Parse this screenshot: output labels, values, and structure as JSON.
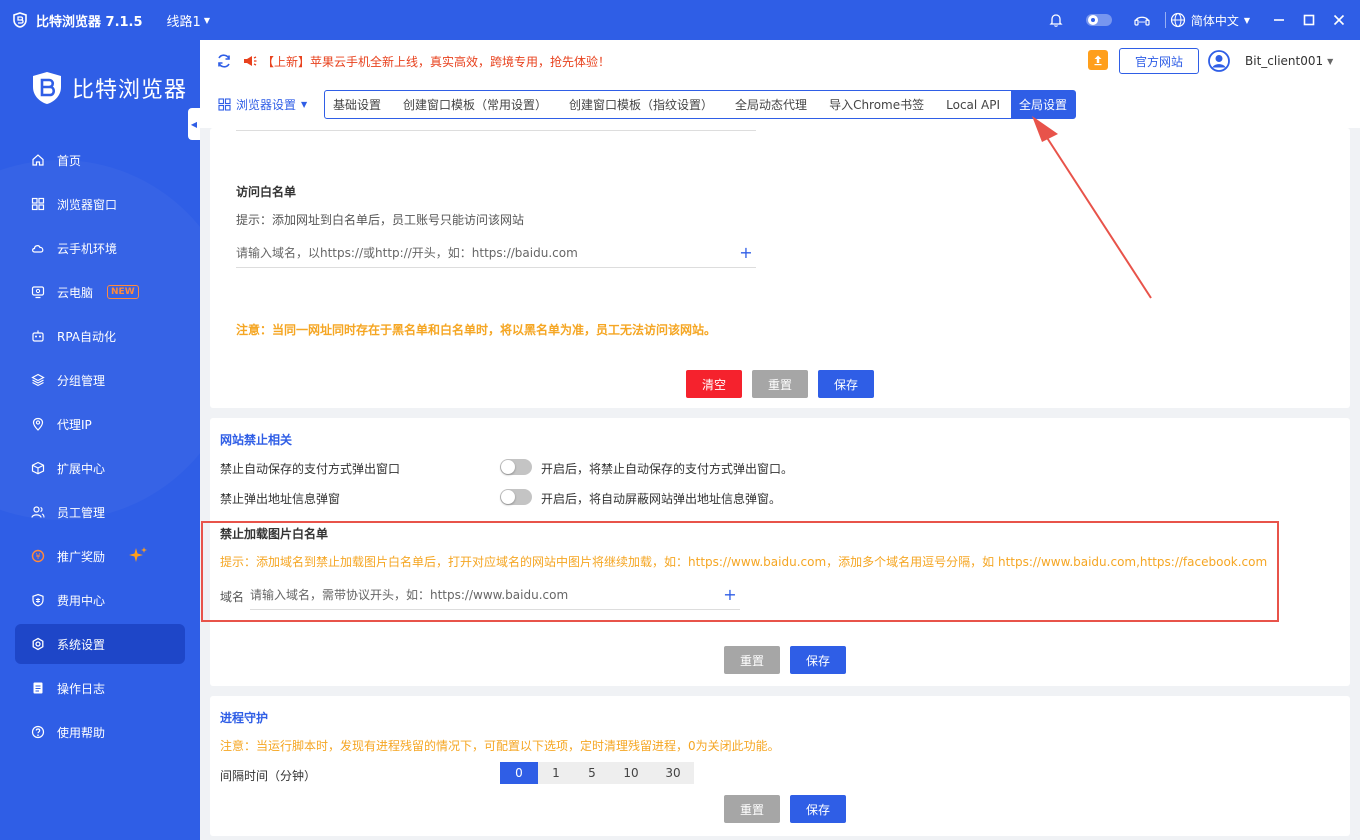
{
  "titlebar": {
    "app_name": "比特浏览器 7.1.5",
    "line": "线路1",
    "language": "简体中文"
  },
  "sidebar": {
    "brand": "比特浏览器",
    "items": [
      {
        "label": "首页",
        "icon": "home-icon"
      },
      {
        "label": "浏览器窗口",
        "icon": "grid-icon"
      },
      {
        "label": "云手机环境",
        "icon": "cloud-icon"
      },
      {
        "label": "云电脑",
        "icon": "monitor-icon",
        "badge": "NEW"
      },
      {
        "label": "RPA自动化",
        "icon": "robot-icon"
      },
      {
        "label": "分组管理",
        "icon": "layers-icon"
      },
      {
        "label": "代理IP",
        "icon": "location-icon"
      },
      {
        "label": "扩展中心",
        "icon": "cube-icon"
      },
      {
        "label": "员工管理",
        "icon": "users-icon"
      },
      {
        "label": "推广奖励",
        "icon": "reward-icon"
      },
      {
        "label": "费用中心",
        "icon": "shield-icon"
      },
      {
        "label": "系统设置",
        "icon": "gear-icon",
        "active": true
      },
      {
        "label": "操作日志",
        "icon": "log-icon"
      },
      {
        "label": "使用帮助",
        "icon": "help-icon"
      }
    ]
  },
  "topbar": {
    "notice": "【上新】苹果云手机全新上线，真实高效，跨境专用，抢先体验！",
    "official_site": "官方网站",
    "username": "Bit_client001"
  },
  "tabbar": {
    "menu_label": "浏览器设置",
    "tabs": [
      "基础设置",
      "创建窗口模板（常用设置）",
      "创建窗口模板（指纹设置）",
      "全局动态代理",
      "导入Chrome书签",
      "Local API",
      "全局设置"
    ],
    "active_tab": "全局设置"
  },
  "whitelist": {
    "title": "访问白名单",
    "hint": "提示：添加网址到白名单后，员工账号只能访问该网站",
    "placeholder": "请输入域名，以https://或http://开头，如：https://baidu.com",
    "note": "注意：当同一网址同时存在于黑名单和白名单时，将以黑名单为准，员工无法访问该网站。",
    "btn_clear": "清空",
    "btn_reset": "重置",
    "btn_save": "保存"
  },
  "site_block": {
    "title": "网站禁止相关",
    "opt1_label": "禁止自动保存的支付方式弹出窗口",
    "opt1_desc": "开启后，将禁止自动保存的支付方式弹出窗口。",
    "opt2_label": "禁止弹出地址信息弹窗",
    "opt2_desc": "开启后，将自动屏蔽网站弹出地址信息弹窗。",
    "img_title": "禁止加载图片白名单",
    "img_hint": "提示：添加域名到禁止加载图片白名单后，打开对应域名的网站中图片将继续加载，如：https://www.baidu.com，添加多个域名用逗号分隔，如 https://www.baidu.com,https://facebook.com",
    "domain_label": "域名",
    "domain_placeholder": "请输入域名，需带协议开头，如：https://www.baidu.com",
    "btn_reset": "重置",
    "btn_save": "保存"
  },
  "process_guard": {
    "title": "进程守护",
    "note": "注意：当运行脚本时，发现有进程残留的情况下，可配置以下选项，定时清理残留进程，0为关闭此功能。",
    "interval_label": "间隔时间（分钟）",
    "options": [
      "0",
      "1",
      "5",
      "10",
      "30"
    ],
    "selected": "0",
    "btn_reset": "重置",
    "btn_save": "保存"
  },
  "colors": {
    "primary": "#2f5ee6",
    "danger": "#f5222d",
    "warning": "#f5a623",
    "annotation": "#e8534a"
  }
}
